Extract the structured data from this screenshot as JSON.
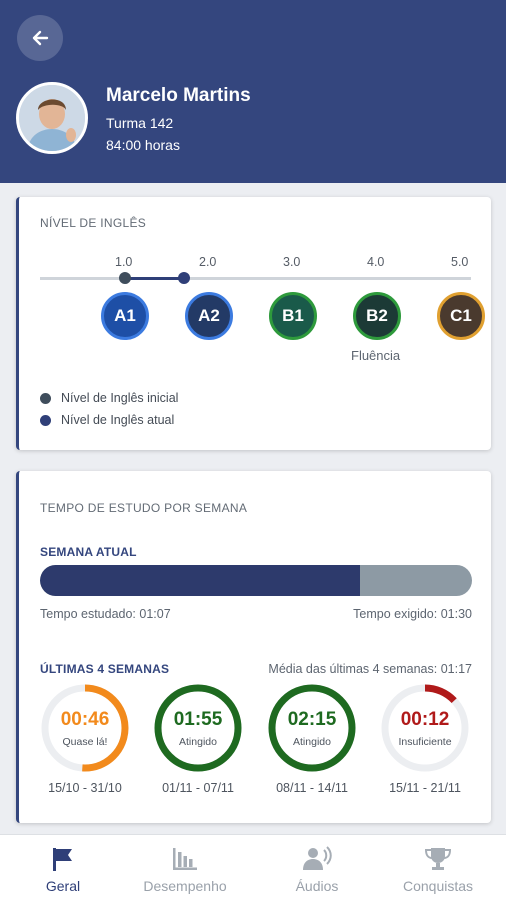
{
  "header": {
    "user_name": "Marcelo Martins",
    "turma": "Turma 142",
    "hours": "84:00 horas"
  },
  "english_level": {
    "title": "NÍVEL DE INGLÊS",
    "scale": [
      "1.0",
      "2.0",
      "3.0",
      "4.0",
      "5.0"
    ],
    "initial_value": 1.0,
    "current_value": 1.7,
    "levels": [
      {
        "code": "A1",
        "fill": "#1e4fa6",
        "border": "#3c7be0"
      },
      {
        "code": "A2",
        "fill": "#233a66",
        "border": "#3c7be0"
      },
      {
        "code": "B1",
        "fill": "#1a5a4a",
        "border": "#2e9a3c"
      },
      {
        "code": "B2",
        "fill": "#1c3a36",
        "border": "#2e9a3c"
      },
      {
        "code": "C1",
        "fill": "#4a3a2e",
        "border": "#e0a030"
      }
    ],
    "fluencia_label": "Fluência",
    "legend_initial": "Nível de Inglês inicial",
    "legend_current": "Nível de Inglês atual",
    "colors": {
      "initial": "#3f4d5c",
      "current": "#2f3f78"
    }
  },
  "study_time": {
    "title": "TEMPO DE ESTUDO POR SEMANA",
    "current_week_title": "SEMANA ATUAL",
    "progress_fraction": 0.74,
    "studied_label": "Tempo estudado: 01:07",
    "required_label": "Tempo exigido: 01:30",
    "last_weeks_title": "ÚLTIMAS 4 SEMANAS",
    "average_label": "Média das últimas 4 semanas: 01:17",
    "weeks": [
      {
        "time": "00:46",
        "status": "Quase lá!",
        "dates": "15/10 - 31/10",
        "fraction": 0.51,
        "color": "#f28a1c"
      },
      {
        "time": "01:55",
        "status": "Atingido",
        "dates": "01/11 - 07/11",
        "fraction": 1.0,
        "color": "#1e6a20"
      },
      {
        "time": "02:15",
        "status": "Atingido",
        "dates": "08/11 - 14/11",
        "fraction": 1.0,
        "color": "#1e6a20"
      },
      {
        "time": "00:12",
        "status": "Insuficiente",
        "dates": "15/11 - 21/11",
        "fraction": 0.13,
        "color": "#b01a1a"
      }
    ]
  },
  "bottom_nav": {
    "items": [
      {
        "label": "Geral",
        "icon": "flag-icon",
        "active": true
      },
      {
        "label": "Desempenho",
        "icon": "bar-chart-icon",
        "active": false
      },
      {
        "label": "Áudios",
        "icon": "speaker-icon",
        "active": false
      },
      {
        "label": "Conquistas",
        "icon": "trophy-icon",
        "active": false
      }
    ]
  }
}
